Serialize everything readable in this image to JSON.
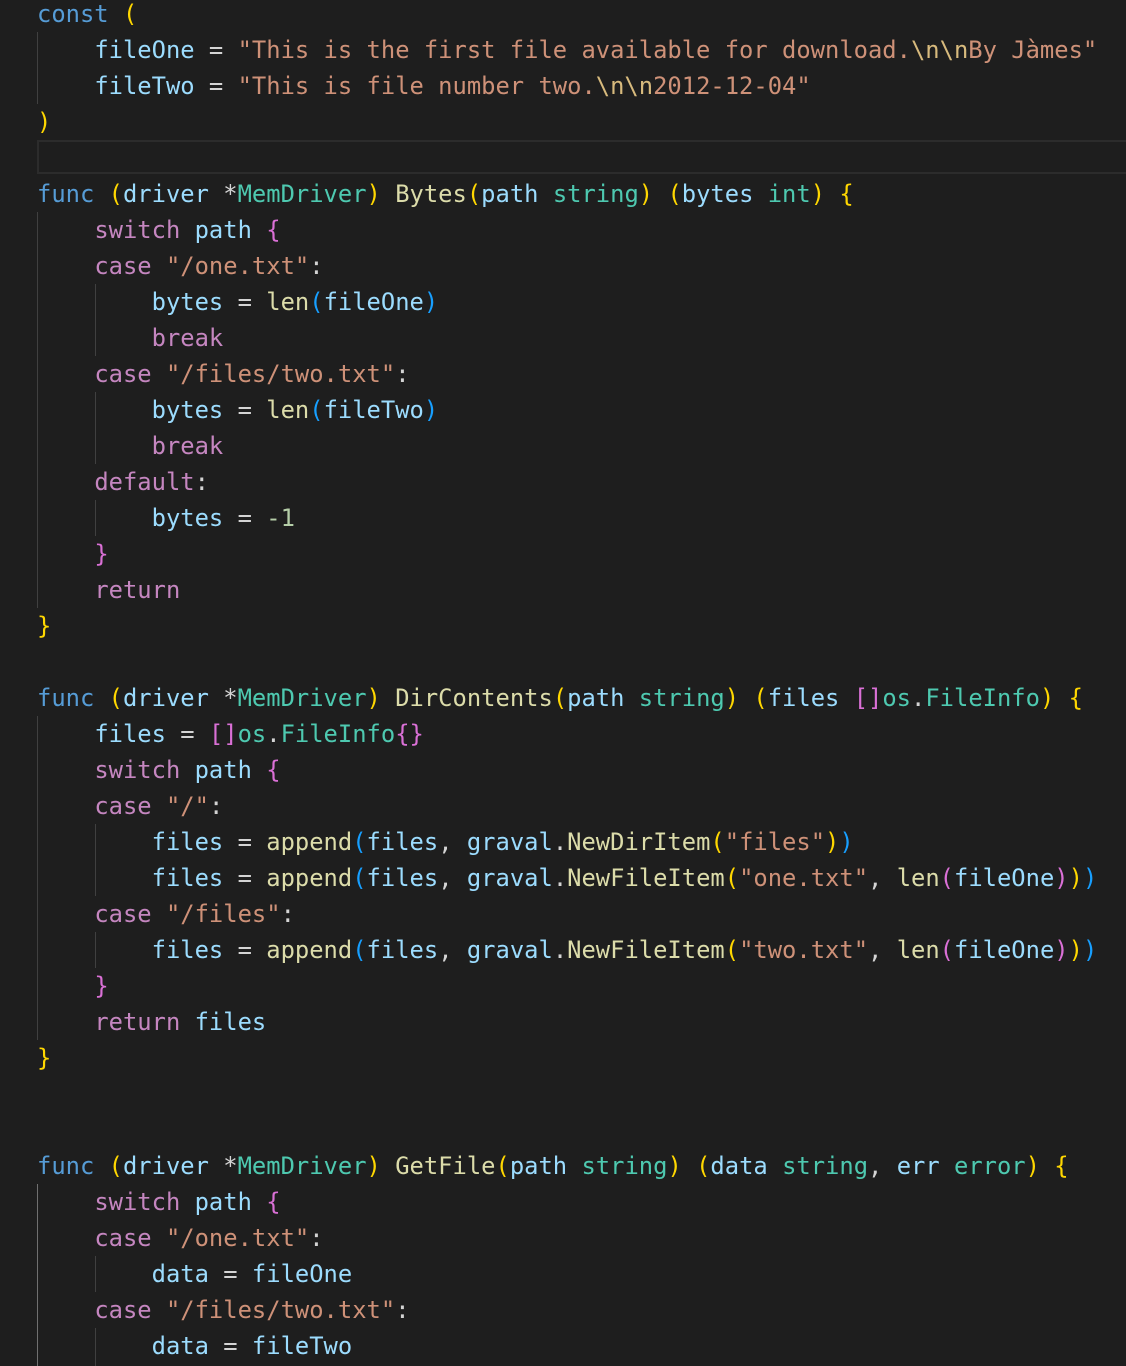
{
  "editor": {
    "language": "Go",
    "theme": "dark",
    "lines": [
      [
        [
          "kw",
          "const"
        ],
        [
          "op",
          " "
        ],
        [
          "b1",
          "("
        ]
      ],
      [
        [
          "op",
          "    "
        ],
        [
          "var",
          "fileOne"
        ],
        [
          "op",
          " = "
        ],
        [
          "str",
          "\"This is the first file available for download."
        ],
        [
          "esc",
          "\\n\\n"
        ],
        [
          "str",
          "By Jàmes\""
        ]
      ],
      [
        [
          "op",
          "    "
        ],
        [
          "var",
          "fileTwo"
        ],
        [
          "op",
          " = "
        ],
        [
          "str",
          "\"This is file number two."
        ],
        [
          "esc",
          "\\n\\n"
        ],
        [
          "str",
          "2012-12-04\""
        ]
      ],
      [
        [
          "b1",
          ")"
        ]
      ],
      [],
      [
        [
          "kw",
          "func"
        ],
        [
          "op",
          " "
        ],
        [
          "b1",
          "("
        ],
        [
          "var",
          "driver"
        ],
        [
          "op",
          " *"
        ],
        [
          "typ",
          "MemDriver"
        ],
        [
          "b1",
          ")"
        ],
        [
          "op",
          " "
        ],
        [
          "fn",
          "Bytes"
        ],
        [
          "b1",
          "("
        ],
        [
          "var",
          "path"
        ],
        [
          "op",
          " "
        ],
        [
          "typ",
          "string"
        ],
        [
          "b1",
          ")"
        ],
        [
          "op",
          " "
        ],
        [
          "b1",
          "("
        ],
        [
          "var",
          "bytes"
        ],
        [
          "op",
          " "
        ],
        [
          "typ",
          "int"
        ],
        [
          "b1",
          ")"
        ],
        [
          "op",
          " "
        ],
        [
          "b1",
          "{"
        ]
      ],
      [
        [
          "op",
          "    "
        ],
        [
          "ctl",
          "switch"
        ],
        [
          "op",
          " "
        ],
        [
          "var",
          "path"
        ],
        [
          "op",
          " "
        ],
        [
          "b2",
          "{"
        ]
      ],
      [
        [
          "op",
          "    "
        ],
        [
          "ctl",
          "case"
        ],
        [
          "op",
          " "
        ],
        [
          "str",
          "\"/one.txt\""
        ],
        [
          "op",
          ":"
        ]
      ],
      [
        [
          "op",
          "        "
        ],
        [
          "var",
          "bytes"
        ],
        [
          "op",
          " = "
        ],
        [
          "fn",
          "len"
        ],
        [
          "b3",
          "("
        ],
        [
          "var",
          "fileOne"
        ],
        [
          "b3",
          ")"
        ]
      ],
      [
        [
          "op",
          "        "
        ],
        [
          "ctl",
          "break"
        ]
      ],
      [
        [
          "op",
          "    "
        ],
        [
          "ctl",
          "case"
        ],
        [
          "op",
          " "
        ],
        [
          "str",
          "\"/files/two.txt\""
        ],
        [
          "op",
          ":"
        ]
      ],
      [
        [
          "op",
          "        "
        ],
        [
          "var",
          "bytes"
        ],
        [
          "op",
          " = "
        ],
        [
          "fn",
          "len"
        ],
        [
          "b3",
          "("
        ],
        [
          "var",
          "fileTwo"
        ],
        [
          "b3",
          ")"
        ]
      ],
      [
        [
          "op",
          "        "
        ],
        [
          "ctl",
          "break"
        ]
      ],
      [
        [
          "op",
          "    "
        ],
        [
          "ctl",
          "default"
        ],
        [
          "op",
          ":"
        ]
      ],
      [
        [
          "op",
          "        "
        ],
        [
          "var",
          "bytes"
        ],
        [
          "op",
          " = "
        ],
        [
          "num",
          "-1"
        ]
      ],
      [
        [
          "op",
          "    "
        ],
        [
          "b2",
          "}"
        ]
      ],
      [
        [
          "op",
          "    "
        ],
        [
          "ctl",
          "return"
        ]
      ],
      [
        [
          "b1",
          "}"
        ]
      ],
      [],
      [
        [
          "kw",
          "func"
        ],
        [
          "op",
          " "
        ],
        [
          "b1",
          "("
        ],
        [
          "var",
          "driver"
        ],
        [
          "op",
          " *"
        ],
        [
          "typ",
          "MemDriver"
        ],
        [
          "b1",
          ")"
        ],
        [
          "op",
          " "
        ],
        [
          "fn",
          "DirContents"
        ],
        [
          "b1",
          "("
        ],
        [
          "var",
          "path"
        ],
        [
          "op",
          " "
        ],
        [
          "typ",
          "string"
        ],
        [
          "b1",
          ")"
        ],
        [
          "op",
          " "
        ],
        [
          "b1",
          "("
        ],
        [
          "var",
          "files"
        ],
        [
          "op",
          " "
        ],
        [
          "b2",
          "[]"
        ],
        [
          "typ",
          "os"
        ],
        [
          "op",
          "."
        ],
        [
          "typ",
          "FileInfo"
        ],
        [
          "b1",
          ")"
        ],
        [
          "op",
          " "
        ],
        [
          "b1",
          "{"
        ]
      ],
      [
        [
          "op",
          "    "
        ],
        [
          "var",
          "files"
        ],
        [
          "op",
          " = "
        ],
        [
          "b2",
          "[]"
        ],
        [
          "typ",
          "os"
        ],
        [
          "op",
          "."
        ],
        [
          "typ",
          "FileInfo"
        ],
        [
          "b2",
          "{}"
        ]
      ],
      [
        [
          "op",
          "    "
        ],
        [
          "ctl",
          "switch"
        ],
        [
          "op",
          " "
        ],
        [
          "var",
          "path"
        ],
        [
          "op",
          " "
        ],
        [
          "b2",
          "{"
        ]
      ],
      [
        [
          "op",
          "    "
        ],
        [
          "ctl",
          "case"
        ],
        [
          "op",
          " "
        ],
        [
          "str",
          "\"/\""
        ],
        [
          "op",
          ":"
        ]
      ],
      [
        [
          "op",
          "        "
        ],
        [
          "var",
          "files"
        ],
        [
          "op",
          " = "
        ],
        [
          "fn",
          "append"
        ],
        [
          "b3",
          "("
        ],
        [
          "var",
          "files"
        ],
        [
          "op",
          ", "
        ],
        [
          "var",
          "graval"
        ],
        [
          "op",
          "."
        ],
        [
          "fn",
          "NewDirItem"
        ],
        [
          "b1",
          "("
        ],
        [
          "str",
          "\"files\""
        ],
        [
          "b1",
          ")"
        ],
        [
          "b3",
          ")"
        ]
      ],
      [
        [
          "op",
          "        "
        ],
        [
          "var",
          "files"
        ],
        [
          "op",
          " = "
        ],
        [
          "fn",
          "append"
        ],
        [
          "b3",
          "("
        ],
        [
          "var",
          "files"
        ],
        [
          "op",
          ", "
        ],
        [
          "var",
          "graval"
        ],
        [
          "op",
          "."
        ],
        [
          "fn",
          "NewFileItem"
        ],
        [
          "b1",
          "("
        ],
        [
          "str",
          "\"one.txt\""
        ],
        [
          "op",
          ", "
        ],
        [
          "fn",
          "len"
        ],
        [
          "b2",
          "("
        ],
        [
          "var",
          "fileOne"
        ],
        [
          "b2",
          ")"
        ],
        [
          "b1",
          ")"
        ],
        [
          "b3",
          ")"
        ]
      ],
      [
        [
          "op",
          "    "
        ],
        [
          "ctl",
          "case"
        ],
        [
          "op",
          " "
        ],
        [
          "str",
          "\"/files\""
        ],
        [
          "op",
          ":"
        ]
      ],
      [
        [
          "op",
          "        "
        ],
        [
          "var",
          "files"
        ],
        [
          "op",
          " = "
        ],
        [
          "fn",
          "append"
        ],
        [
          "b3",
          "("
        ],
        [
          "var",
          "files"
        ],
        [
          "op",
          ", "
        ],
        [
          "var",
          "graval"
        ],
        [
          "op",
          "."
        ],
        [
          "fn",
          "NewFileItem"
        ],
        [
          "b1",
          "("
        ],
        [
          "str",
          "\"two.txt\""
        ],
        [
          "op",
          ", "
        ],
        [
          "fn",
          "len"
        ],
        [
          "b2",
          "("
        ],
        [
          "var",
          "fileOne"
        ],
        [
          "b2",
          ")"
        ],
        [
          "b1",
          ")"
        ],
        [
          "b3",
          ")"
        ]
      ],
      [
        [
          "op",
          "    "
        ],
        [
          "b2",
          "}"
        ]
      ],
      [
        [
          "op",
          "    "
        ],
        [
          "ctl",
          "return"
        ],
        [
          "op",
          " "
        ],
        [
          "var",
          "files"
        ]
      ],
      [
        [
          "b1",
          "}"
        ]
      ],
      [],
      [],
      [
        [
          "kw",
          "func"
        ],
        [
          "op",
          " "
        ],
        [
          "b1",
          "("
        ],
        [
          "var",
          "driver"
        ],
        [
          "op",
          " *"
        ],
        [
          "typ",
          "MemDriver"
        ],
        [
          "b1",
          ")"
        ],
        [
          "op",
          " "
        ],
        [
          "fn",
          "GetFile"
        ],
        [
          "b1",
          "("
        ],
        [
          "var",
          "path"
        ],
        [
          "op",
          " "
        ],
        [
          "typ",
          "string"
        ],
        [
          "b1",
          ")"
        ],
        [
          "op",
          " "
        ],
        [
          "b1",
          "("
        ],
        [
          "var",
          "data"
        ],
        [
          "op",
          " "
        ],
        [
          "typ",
          "string"
        ],
        [
          "op",
          ", "
        ],
        [
          "var",
          "err"
        ],
        [
          "op",
          " "
        ],
        [
          "typ",
          "error"
        ],
        [
          "b1",
          ")"
        ],
        [
          "op",
          " "
        ],
        [
          "b1",
          "{"
        ]
      ],
      [
        [
          "op",
          "    "
        ],
        [
          "ctl",
          "switch"
        ],
        [
          "op",
          " "
        ],
        [
          "var",
          "path"
        ],
        [
          "op",
          " "
        ],
        [
          "b2",
          "{"
        ]
      ],
      [
        [
          "op",
          "    "
        ],
        [
          "ctl",
          "case"
        ],
        [
          "op",
          " "
        ],
        [
          "str",
          "\"/one.txt\""
        ],
        [
          "op",
          ":"
        ]
      ],
      [
        [
          "op",
          "        "
        ],
        [
          "var",
          "data"
        ],
        [
          "op",
          " = "
        ],
        [
          "var",
          "fileOne"
        ]
      ],
      [
        [
          "op",
          "    "
        ],
        [
          "ctl",
          "case"
        ],
        [
          "op",
          " "
        ],
        [
          "str",
          "\"/files/two.txt\""
        ],
        [
          "op",
          ":"
        ]
      ],
      [
        [
          "op",
          "        "
        ],
        [
          "var",
          "data"
        ],
        [
          "op",
          " = "
        ],
        [
          "var",
          "fileTwo"
        ]
      ]
    ],
    "colors": {
      "background": "#1e1e1e",
      "keyword": "#569cd6",
      "control": "#c586c0",
      "variable": "#9cdcfe",
      "type": "#4ec9b0",
      "function": "#dcdcaa",
      "string": "#ce9178",
      "escape": "#d7ba7d",
      "number": "#b5cea8",
      "bracket_1": "#ffd700",
      "bracket_2": "#da70d6",
      "bracket_3": "#179fff"
    }
  }
}
